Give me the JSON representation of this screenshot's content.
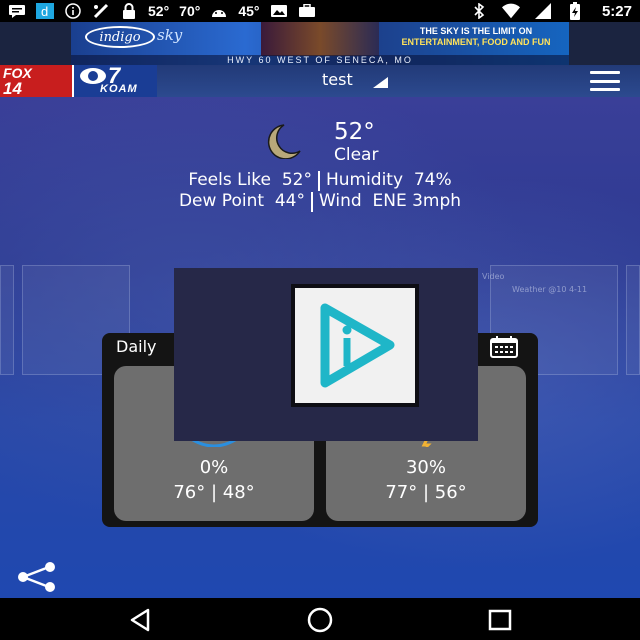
{
  "status_bar": {
    "temp1": "52°",
    "temp2": "70°",
    "temp3": "45°",
    "time": "5:27",
    "icons": [
      "message-icon",
      "d-app-icon",
      "info-icon",
      "fix-icon",
      "lock-icon",
      "android-icon",
      "photos-icon",
      "briefcase-icon",
      "bluetooth-icon",
      "wifi-icon",
      "signal-icon",
      "battery-icon"
    ]
  },
  "ad": {
    "logo": "indigo",
    "logo_suffix": "sky",
    "headline_line1": "THE SKY IS THE LIMIT ON",
    "headline_line2": "ENTERTAINMENT, FOOD AND FUN",
    "footer": "HWY 60 WEST OF SENECA, MO"
  },
  "header": {
    "logo_fox": "FOX",
    "logo_fox_num": "14",
    "logo_cbs_num": "7",
    "logo_koam": "KOAM",
    "location": "test"
  },
  "current": {
    "temperature": "52°",
    "condition": "Clear",
    "feels_like_label": "Feels Like",
    "feels_like_value": "52°",
    "humidity_label": "Humidity",
    "humidity_value": "74%",
    "dew_point_label": "Dew Point",
    "dew_point_value": "44°",
    "wind_label": "Wind",
    "wind_value": "ENE 3mph"
  },
  "background_ghost": {
    "video_label": "Video",
    "weather_label": "Weather @10 4-11"
  },
  "daily": {
    "title": "Daily",
    "days": [
      {
        "precip": "0%",
        "temps": "76° | 48°"
      },
      {
        "precip": "30%",
        "temps": "77° | 56°"
      }
    ]
  },
  "colors": {
    "moon": "#b8a87a",
    "overlay_bg": "#262848",
    "overlay_logo_accent": "#1fb6c8",
    "card_bg": "#141414",
    "tile_bg": "#6e6e6e"
  }
}
